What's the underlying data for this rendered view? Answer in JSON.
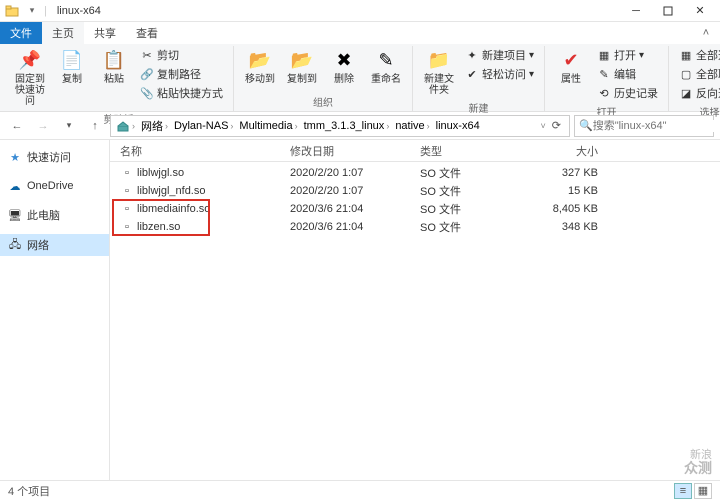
{
  "window": {
    "title": "linux-x64"
  },
  "tabs": {
    "file": "文件",
    "home": "主页",
    "share": "共享",
    "view": "查看"
  },
  "ribbon": {
    "pin": "固定到快速访问",
    "copy": "复制",
    "paste": "粘贴",
    "cut": "剪切",
    "copypath": "复制路径",
    "pasteshortcut": "粘贴快捷方式",
    "group_clipboard": "剪贴板",
    "moveto": "移动到",
    "copyto": "复制到",
    "delete": "删除",
    "rename": "重命名",
    "group_organize": "组织",
    "newfolder": "新建文件夹",
    "newitem": "新建项目",
    "easyaccess": "轻松访问",
    "group_new": "新建",
    "properties": "属性",
    "open": "打开",
    "edit": "编辑",
    "history": "历史记录",
    "group_open": "打开",
    "selectall": "全部选择",
    "selectnone": "全部取消",
    "invert": "反向选择",
    "group_select": "选择"
  },
  "breadcrumb": [
    "网络",
    "Dylan-NAS",
    "Multimedia",
    "tmm_3.1.3_linux",
    "native",
    "linux-x64"
  ],
  "search": {
    "placeholder": "搜索\"linux-x64\""
  },
  "sidebar": {
    "quick": "快速访问",
    "onedrive": "OneDrive",
    "thispc": "此电脑",
    "network": "网络"
  },
  "columns": {
    "name": "名称",
    "date": "修改日期",
    "type": "类型",
    "size": "大小"
  },
  "files": [
    {
      "name": "liblwjgl.so",
      "date": "2020/2/20 1:07",
      "type": "SO 文件",
      "size": "327 KB"
    },
    {
      "name": "liblwjgl_nfd.so",
      "date": "2020/2/20 1:07",
      "type": "SO 文件",
      "size": "15 KB"
    },
    {
      "name": "libmediainfo.so",
      "date": "2020/3/6 21:04",
      "type": "SO 文件",
      "size": "8,405 KB"
    },
    {
      "name": "libzen.so",
      "date": "2020/3/6 21:04",
      "type": "SO 文件",
      "size": "348 KB"
    }
  ],
  "status": {
    "count": "4 个项目"
  },
  "watermark": {
    "l1": "新浪",
    "l2": "众测"
  }
}
